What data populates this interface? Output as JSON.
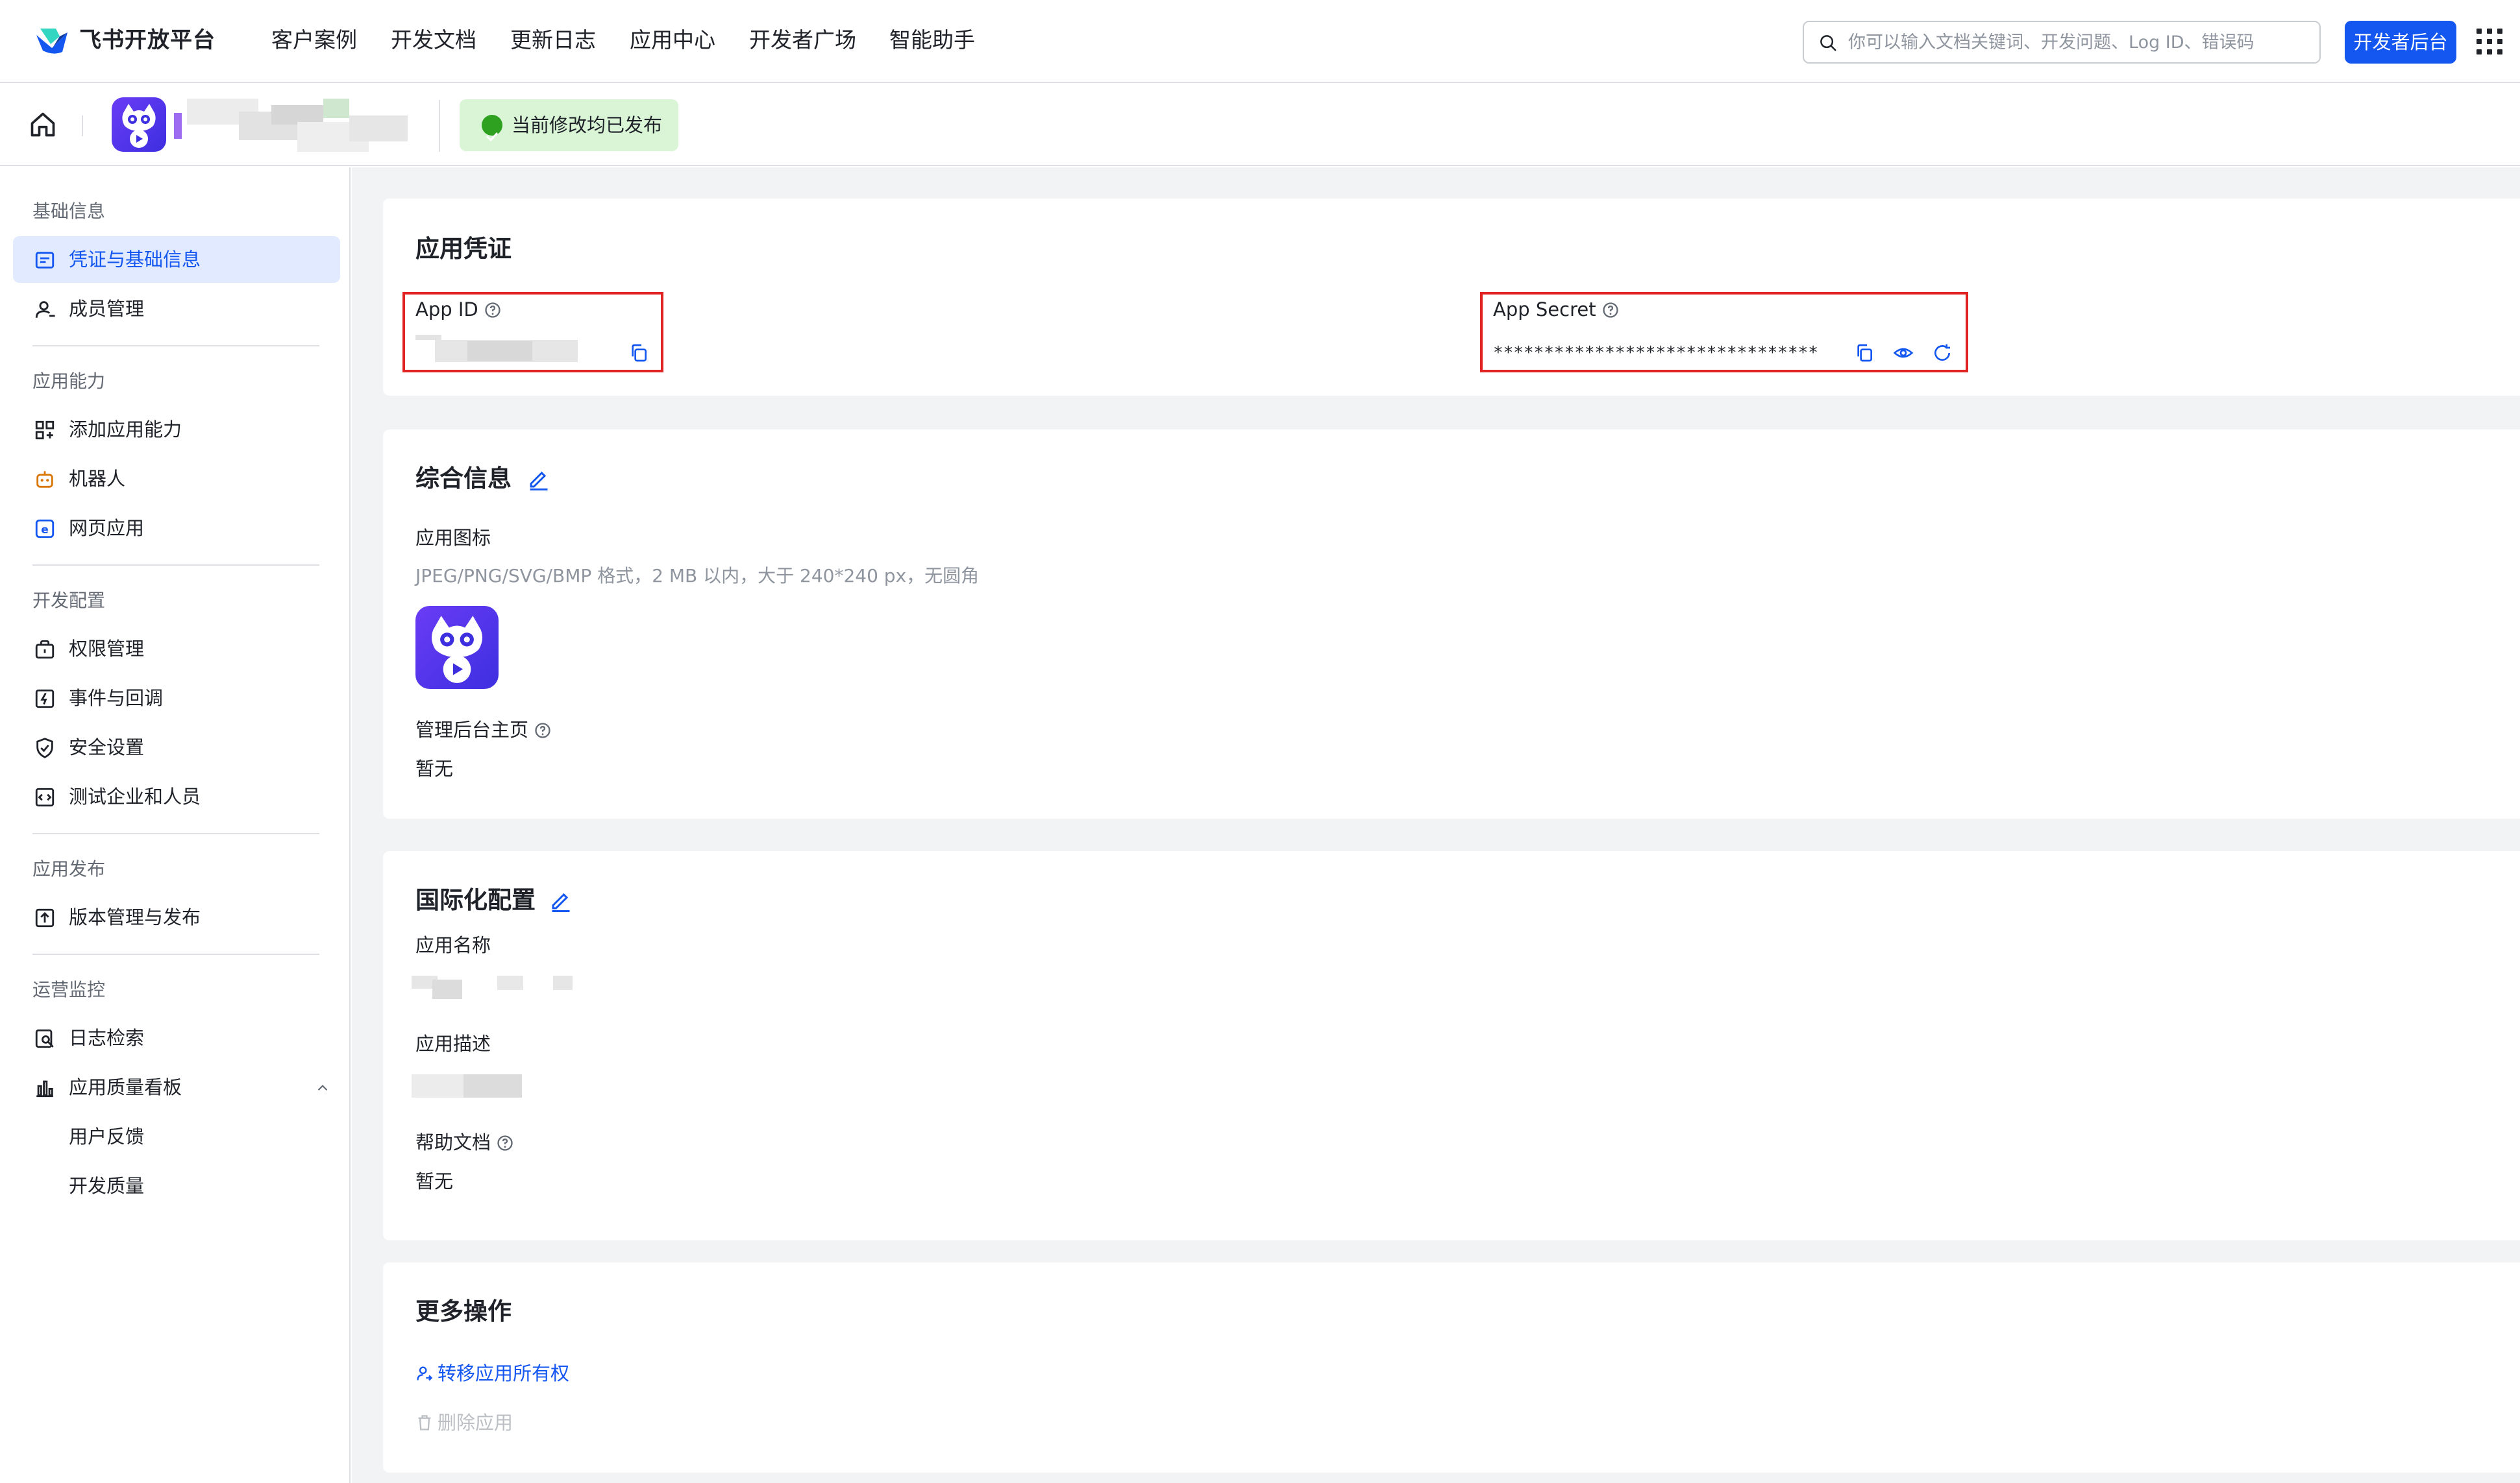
{
  "brand": {
    "name": "飞书开放平台",
    "accent": "#1456f0"
  },
  "topnav": {
    "items": [
      "客户案例",
      "开发文档",
      "更新日志",
      "应用中心",
      "开发者广场",
      "智能助手"
    ],
    "search_placeholder": "你可以输入文档关键词、开发问题、Log ID、错误码",
    "console_button": "开发者后台"
  },
  "subheader": {
    "status_text": "当前修改均已发布",
    "status_color": "#2ea121"
  },
  "sidebar": {
    "groups": [
      {
        "title": "基础信息",
        "items": [
          {
            "label": "凭证与基础信息",
            "icon": "credential-icon",
            "active": true
          },
          {
            "label": "成员管理",
            "icon": "member-icon"
          }
        ]
      },
      {
        "title": "应用能力",
        "items": [
          {
            "label": "添加应用能力",
            "icon": "add-capability-icon"
          },
          {
            "label": "机器人",
            "icon": "robot-icon"
          },
          {
            "label": "网页应用",
            "icon": "web-app-icon"
          }
        ]
      },
      {
        "title": "开发配置",
        "items": [
          {
            "label": "权限管理",
            "icon": "permission-icon"
          },
          {
            "label": "事件与回调",
            "icon": "event-icon"
          },
          {
            "label": "安全设置",
            "icon": "shield-icon"
          },
          {
            "label": "测试企业和人员",
            "icon": "test-icon"
          }
        ]
      },
      {
        "title": "应用发布",
        "items": [
          {
            "label": "版本管理与发布",
            "icon": "release-icon"
          }
        ]
      },
      {
        "title": "运营监控",
        "items": [
          {
            "label": "日志检索",
            "icon": "log-search-icon"
          },
          {
            "label": "应用质量看板",
            "icon": "chart-icon",
            "expanded": true
          },
          {
            "label": "用户反馈",
            "sub": true
          },
          {
            "label": "开发质量",
            "sub": true
          }
        ]
      }
    ]
  },
  "credentials": {
    "title": "应用凭证",
    "app_id_label": "App ID",
    "app_secret_label": "App Secret",
    "app_secret_masked": "********************************"
  },
  "general": {
    "title": "综合信息",
    "icon_label": "应用图标",
    "icon_hint": "JPEG/PNG/SVG/BMP 格式，2 MB 以内，大于 240*240 px，无圆角",
    "homepage_label": "管理后台主页",
    "homepage_value": "暂无"
  },
  "i18n": {
    "title": "国际化配置",
    "name_label": "应用名称",
    "desc_label": "应用描述",
    "help_label": "帮助文档",
    "help_value": "暂无"
  },
  "more": {
    "title": "更多操作",
    "transfer": "转移应用所有权",
    "delete": "删除应用"
  }
}
